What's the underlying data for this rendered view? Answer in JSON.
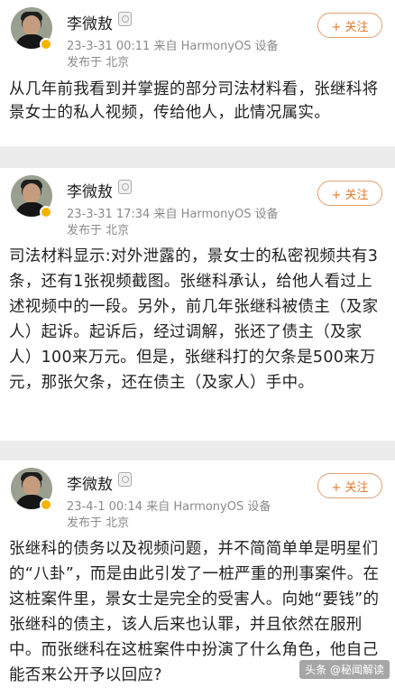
{
  "posts": [
    {
      "author": "李微敖",
      "time": "23-3-31 00:11",
      "source": "来自 HarmonyOS 设备",
      "location": "发布于 北京",
      "follow_label": "+ 关注",
      "content": "从几年前我看到并掌握的部分司法材料看，张继科将景女士的私人视频，传给他人，此情况属实。"
    },
    {
      "author": "李微敖",
      "time": "23-3-31 17:34",
      "source": "来自 HarmonyOS 设备",
      "location": "发布于 北京",
      "follow_label": "+ 关注",
      "content": "司法材料显示:对外泄露的，景女士的私密视频共有3条，还有1张视频截图。张继科承认，给他人看过上述视频中的一段。另外，前几年张继科被债主（及家人）起诉。起诉后，经过调解，张还了债主（及家人）100来万元。但是，张继科打的欠条是500来万元，那张欠条，还在债主（及家人）手中。"
    },
    {
      "author": "李微敖",
      "time": "23-4-1 00:14",
      "source": "来自 HarmonyOS 设备",
      "location": "发布于 北京",
      "follow_label": "+ 关注",
      "content": "张继科的债务以及视频问题，并不简简单单是明星们的“八卦”，而是由此引发了一桩严重的刑事案件。在这桩案件里，景女士是完全的受害人。向她“要钱”的张继科的债主，该人后来也认罪，并且依然在服刑中。而张继科在这桩案件中扮演了什么角色，他自己能否来公开予以回应?"
    }
  ],
  "watermark": "头条 @秘闻解读"
}
